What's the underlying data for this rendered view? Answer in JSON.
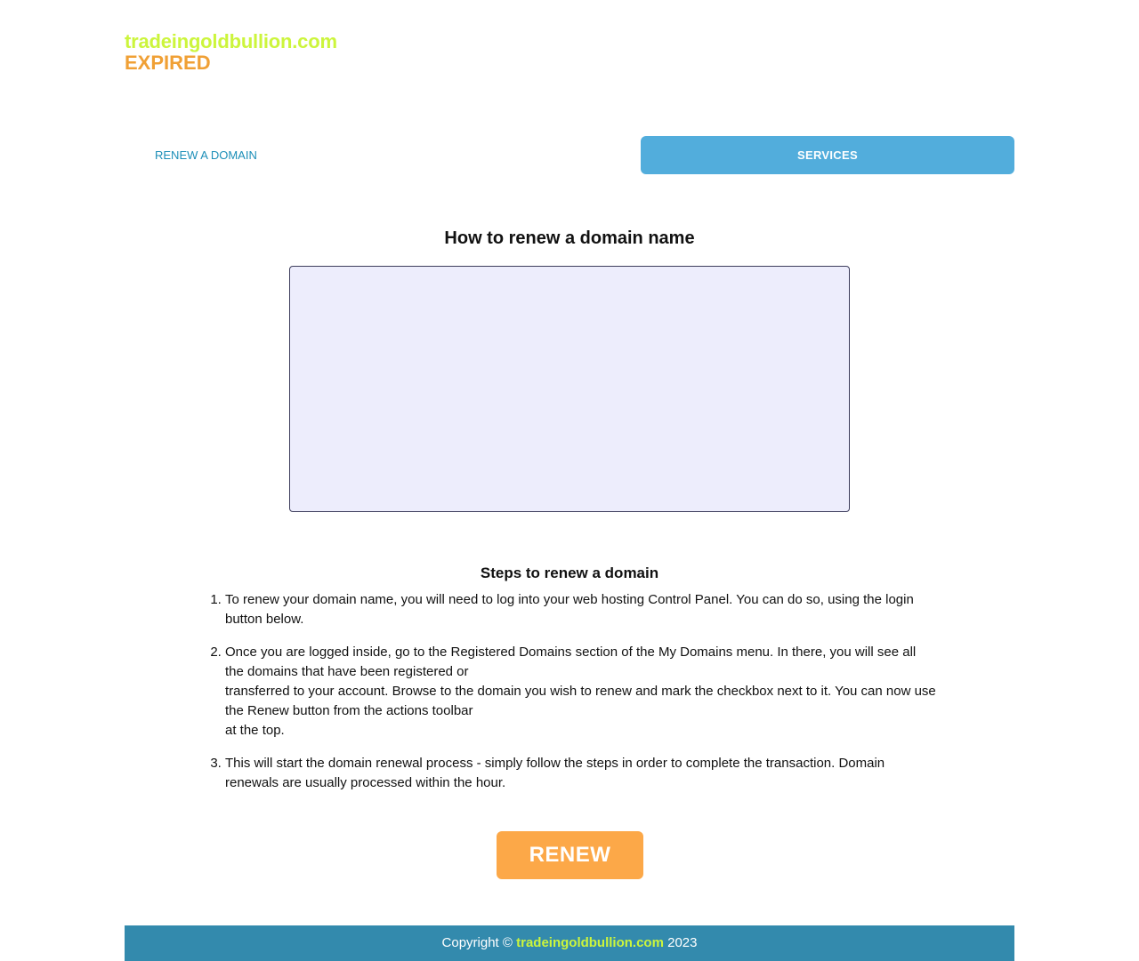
{
  "colors": {
    "brand_domain": "#ccf53c",
    "brand_status": "#f0a035",
    "nav_link": "#1d8fb8",
    "services_button_bg": "#52addc",
    "video_box_bg": "#ededfc",
    "video_box_border": "#3d3d5c",
    "renew_button_bg": "#fca848",
    "footer_bg": "#338aad",
    "footer_domain": "#ccf53c"
  },
  "header": {
    "domain": "tradeingoldbullion.com",
    "status": "EXPIRED"
  },
  "nav": {
    "renew_link": "RENEW A DOMAIN",
    "services_button": "SERVICES"
  },
  "main": {
    "howto_title": "How to renew a domain name",
    "steps_title": "Steps to renew a domain",
    "steps": [
      {
        "lines": [
          "To renew your domain name, you will need to log into your web hosting Control Panel. You can do so, using the login button below."
        ]
      },
      {
        "lines": [
          "Once you are logged inside, go to the Registered Domains section of the My Domains menu. In there, you will see all the domains that have been registered or",
          "transferred to your account. Browse to the domain you wish to renew and mark the checkbox next to it. You can now use the Renew button from the actions toolbar",
          "at the top."
        ]
      },
      {
        "lines": [
          "This will start the domain renewal process - simply follow the steps in order to complete the transaction. Domain renewals are usually processed within the hour."
        ]
      }
    ],
    "renew_button": "RENEW"
  },
  "footer": {
    "prefix": "Copyright ©",
    "domain": "tradeingoldbullion.com",
    "year": "2023"
  }
}
